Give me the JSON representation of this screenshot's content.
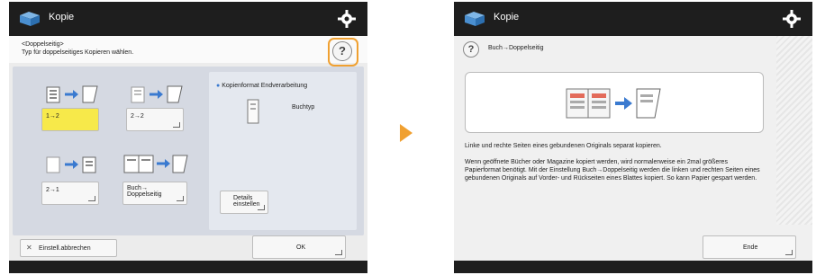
{
  "left_screen": {
    "title": "Kopie",
    "header_line1": "<Doppelseitig>",
    "header_line2": "Typ für doppelseitiges Kopieren wählen.",
    "options": [
      {
        "label": "1→2",
        "selected": true
      },
      {
        "label": "2→2",
        "selected": false
      },
      {
        "label": "2→1",
        "selected": false
      },
      {
        "label": "Buch→\nDoppelseitig",
        "selected": false
      }
    ],
    "format_title": "Kopienformat Endverarbeitung",
    "format_value": "Buchtyp",
    "details_button": "Details\neinstellen",
    "cancel_button": "Einstell.abbrechen",
    "ok_button": "OK"
  },
  "right_screen": {
    "title": "Kopie",
    "help_title": "Buch→Doppelseitig",
    "desc1": "Linke und rechte Seiten eines gebundenen Originals separat kopieren.",
    "desc2": "Wenn geöffnete Bücher oder Magazine kopiert werden, wird normalerweise ein 2mal größeres Papierformat benötigt. Mit der Einstellung Buch→Doppelseitig werden die linken und rechten Seiten eines gebundenen Originals auf Vorder- und Rückseiten eines Blattes kopiert. So kann Papier gespart werden.",
    "end_button": "Ende"
  },
  "colors": {
    "accent": "#f0a030",
    "selected": "#f7e94a",
    "titlebar": "#1e1e1e",
    "panel": "#d5d9e2"
  }
}
